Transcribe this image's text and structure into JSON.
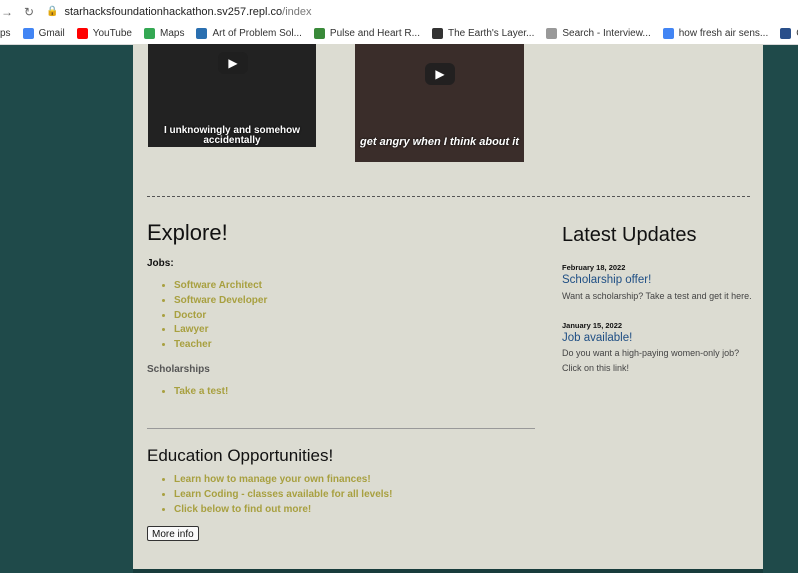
{
  "browser": {
    "url_host": "starhacksfoundationhackathon.sv257.repl.co",
    "url_path": "/index",
    "bookmarks": [
      {
        "label": "ps",
        "icon": "apps-icon",
        "color": "#4285f4"
      },
      {
        "label": "Gmail",
        "icon": "google-icon",
        "color": "#4285f4"
      },
      {
        "label": "YouTube",
        "icon": "youtube-icon",
        "color": "#ff0000"
      },
      {
        "label": "Maps",
        "icon": "maps-icon",
        "color": "#34a853"
      },
      {
        "label": "Art of Problem Sol...",
        "icon": "aops-icon",
        "color": "#2a6fb0"
      },
      {
        "label": "Pulse and Heart R...",
        "icon": "pulse-icon",
        "color": "#3a8a3a"
      },
      {
        "label": "The Earth's Layer...",
        "icon": "globe-icon",
        "color": "#333333"
      },
      {
        "label": "Search - Interview...",
        "icon": "search-site-icon",
        "color": "#999999"
      },
      {
        "label": "how fresh air sens...",
        "icon": "google-icon",
        "color": "#4285f4"
      },
      {
        "label": "Opioid Overdose...",
        "icon": "k-icon",
        "color": "#2a4f8a"
      }
    ]
  },
  "videos": [
    {
      "caption": "I unknowingly and somehow accidentally"
    },
    {
      "caption": "get angry when I think about it"
    }
  ],
  "explore": {
    "title": "Explore!",
    "jobs_label": "Jobs:",
    "jobs": [
      "Software Architect",
      "Software Developer",
      "Doctor",
      "Lawyer",
      "Teacher"
    ],
    "scholarships_label": "Scholarships",
    "scholarships": [
      "Take a test!"
    ]
  },
  "education": {
    "title": "Education Opportunities!",
    "items": [
      "Learn how to manage your own finances!",
      "Learn Coding - classes available for all levels!",
      "Click below to find out more!"
    ],
    "button": "More info"
  },
  "updates": {
    "title": "Latest Updates",
    "posts": [
      {
        "date": "February 18, 2022",
        "title": "Scholarship offer!",
        "text": "Want a scholarship? Take a test and get it here."
      },
      {
        "date": "January 15, 2022",
        "title": "Job available!",
        "text": "Do you want a high-paying women-only job? Click on this link!"
      }
    ]
  },
  "colors": {
    "link": "#a8a040",
    "update_title": "#1e4e84",
    "page_bg": "#dcdcd2",
    "outer_bg": "#1f4a4a"
  }
}
